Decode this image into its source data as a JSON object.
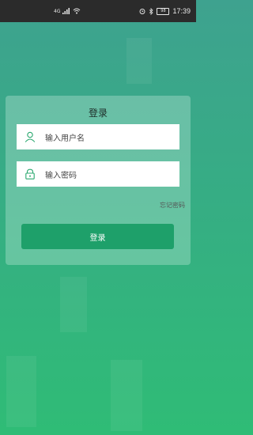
{
  "status_bar": {
    "time": "17:39",
    "network_type": "4G",
    "battery_level": "98"
  },
  "login": {
    "title": "登录",
    "username_placeholder": "输入用户名",
    "password_placeholder": "输入密码",
    "forgot_password": "忘记密码",
    "submit_label": "登录"
  },
  "colors": {
    "background_top": "#3ea28f",
    "background_bottom": "#2fbc76",
    "button": "#1ea06a",
    "icon": "#2aa86f"
  },
  "icons": {
    "username_icon": "user-icon",
    "password_icon": "lock-icon"
  }
}
